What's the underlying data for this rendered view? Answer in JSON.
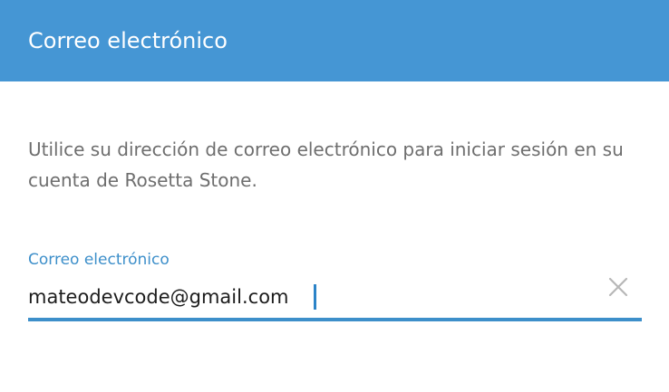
{
  "header": {
    "title": "Correo electrónico"
  },
  "content": {
    "description": "Utilice su dirección de correo electrónico para iniciar sesión en su cuenta de Rosetta Stone."
  },
  "email_field": {
    "label": "Correo electrónico",
    "value": "mateodevcode@gmail.com",
    "clear_icon": "close-icon"
  },
  "colors": {
    "header_background": "#4596d4",
    "accent": "#3d8fca",
    "header_text": "#ffffff",
    "body_text": "#6e6e6e",
    "input_text": "#1d1d1d",
    "clear_icon": "#b7b7b7"
  }
}
